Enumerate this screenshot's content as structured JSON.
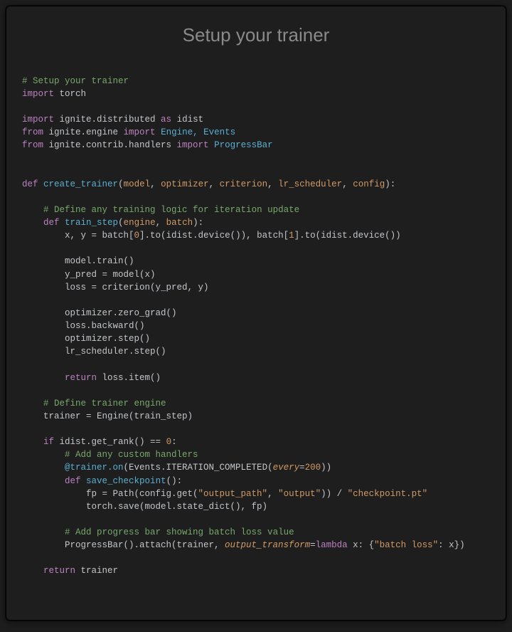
{
  "title": "Setup your trainer",
  "code": {
    "l01": "# Setup your trainer",
    "l02a": "import",
    "l02b": " torch",
    "l03": "",
    "l04a": "import",
    "l04b": " ignite.distributed ",
    "l04c": "as",
    "l04d": " idist",
    "l05a": "from",
    "l05b": " ignite.engine ",
    "l05c": "import",
    "l05d": " Engine, Events",
    "l06a": "from",
    "l06b": " ignite.contrib.handlers ",
    "l06c": "import",
    "l06d": " ProgressBar",
    "l07": "",
    "l08": "",
    "l09a": "def",
    "l09b": " ",
    "l09c": "create_trainer",
    "l09d": "(",
    "l09e": "model",
    "l09f": ", ",
    "l09g": "optimizer",
    "l09h": ", ",
    "l09i": "criterion",
    "l09j": ", ",
    "l09k": "lr_scheduler",
    "l09l": ", ",
    "l09m": "config",
    "l09n": "):",
    "l10": "",
    "l11a": "    ",
    "l11b": "# Define any training logic for iteration update",
    "l12a": "    ",
    "l12b": "def",
    "l12c": " ",
    "l12d": "train_step",
    "l12e": "(",
    "l12f": "engine",
    "l12g": ", ",
    "l12h": "batch",
    "l12i": "):",
    "l13a": "        x, y = batch[",
    "l13b": "0",
    "l13c": "].to(idist.device()), batch[",
    "l13d": "1",
    "l13e": "].to(idist.device())",
    "l14": "",
    "l15": "        model.train()",
    "l16": "        y_pred = model(x)",
    "l17": "        loss = criterion(y_pred, y)",
    "l18": "",
    "l19": "        optimizer.zero_grad()",
    "l20": "        loss.backward()",
    "l21": "        optimizer.step()",
    "l22": "        lr_scheduler.step()",
    "l23": "",
    "l24a": "        ",
    "l24b": "return",
    "l24c": " loss.item()",
    "l25": "",
    "l26a": "    ",
    "l26b": "# Define trainer engine",
    "l27": "    trainer = Engine(train_step)",
    "l28": "",
    "l29a": "    ",
    "l29b": "if",
    "l29c": " idist.get_rank() == ",
    "l29d": "0",
    "l29e": ":",
    "l30a": "        ",
    "l30b": "# Add any custom handlers",
    "l31a": "        ",
    "l31b": "@trainer.on",
    "l31c": "(Events.ITERATION_COMPLETED(",
    "l31d": "every",
    "l31e": "=",
    "l31f": "200",
    "l31g": "))",
    "l32a": "        ",
    "l32b": "def",
    "l32c": " ",
    "l32d": "save_checkpoint",
    "l32e": "():",
    "l33a": "            fp = Path(config.get(",
    "l33b": "\"output_path\"",
    "l33c": ", ",
    "l33d": "\"output\"",
    "l33e": ")) / ",
    "l33f": "\"checkpoint.pt\"",
    "l34": "            torch.save(model.state_dict(), fp)",
    "l35": "",
    "l36a": "        ",
    "l36b": "# Add progress bar showing batch loss value",
    "l37a": "        ProgressBar().attach(trainer, ",
    "l37b": "output_transform",
    "l37c": "=",
    "l37d": "lambda",
    "l37e": " x: {",
    "l37f": "\"batch loss\"",
    "l37g": ": x})",
    "l38": "",
    "l39a": "    ",
    "l39b": "return",
    "l39c": " trainer"
  }
}
